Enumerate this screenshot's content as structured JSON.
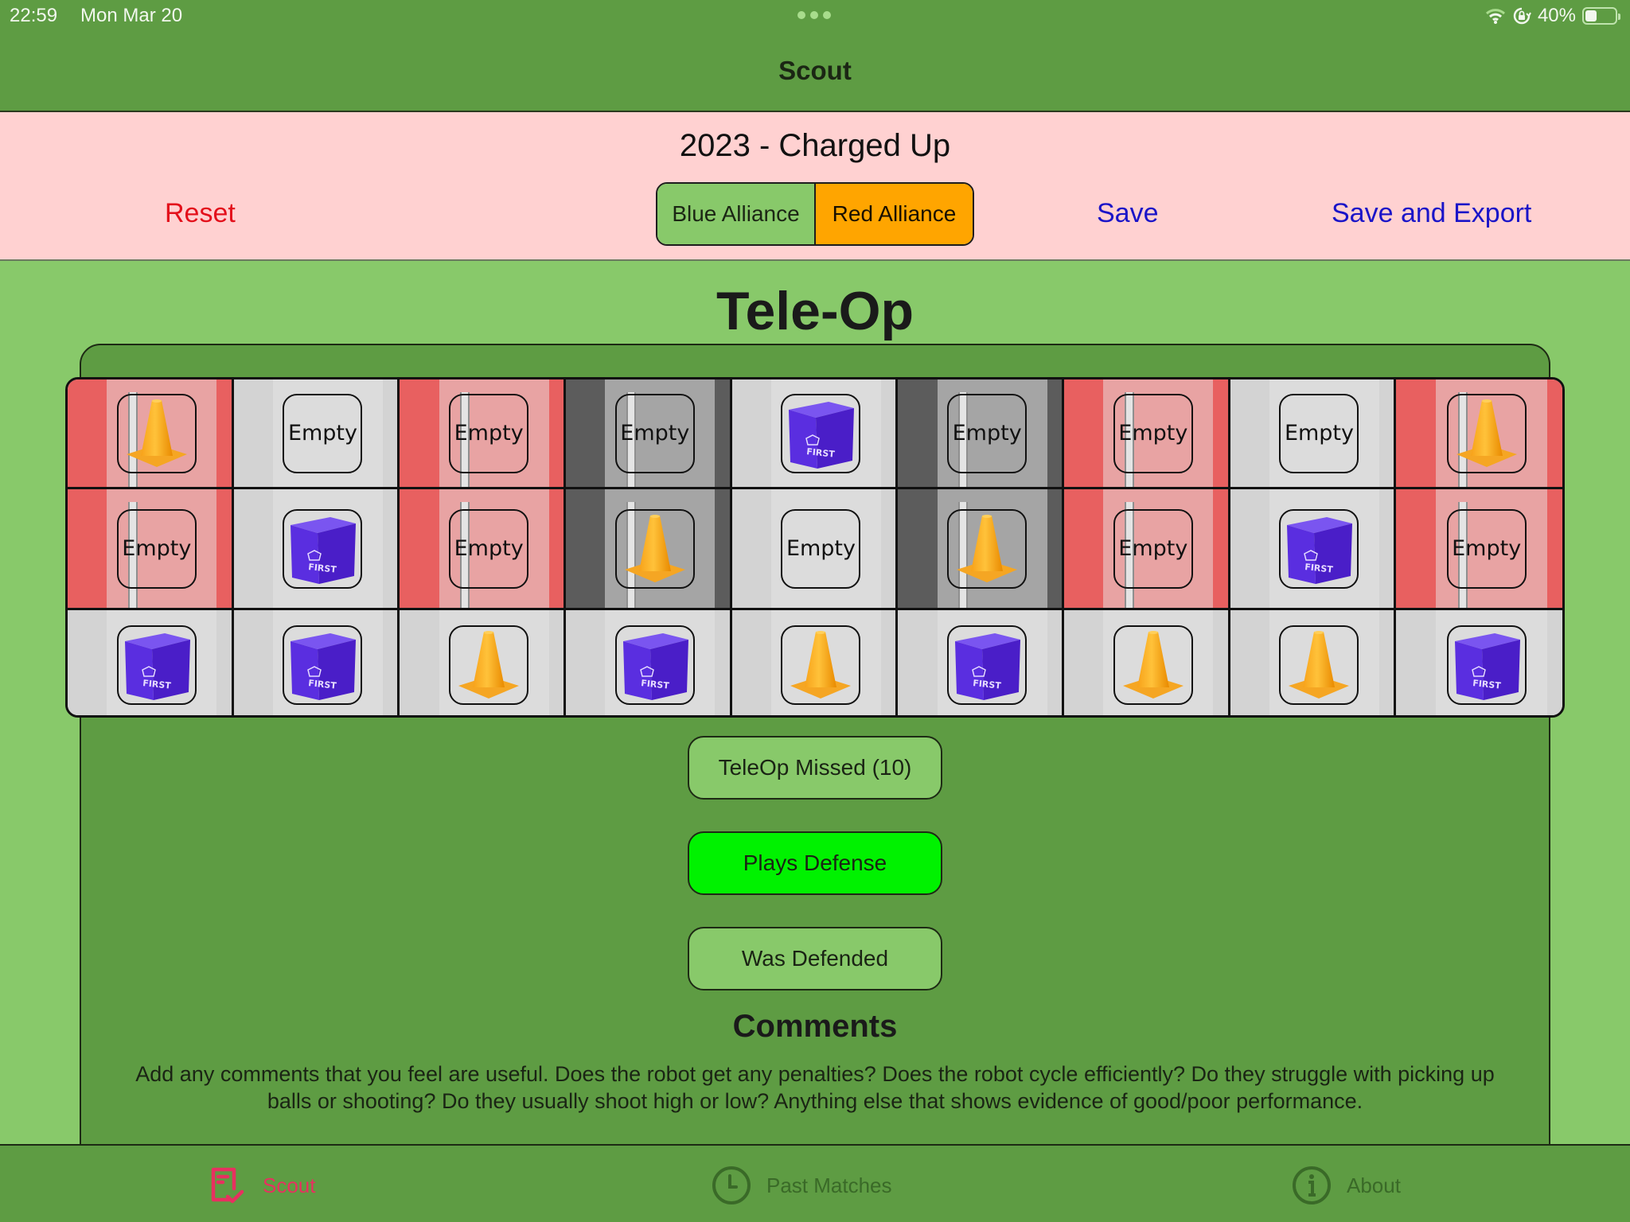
{
  "status_bar": {
    "time": "22:59",
    "date": "Mon Mar 20",
    "battery_percent": "40%",
    "battery_level": 0.4,
    "icons": [
      "wifi-icon",
      "orientation-lock-icon",
      "battery-icon"
    ]
  },
  "nav": {
    "title": "Scout"
  },
  "header": {
    "game_title": "2023 - Charged Up",
    "reset_label": "Reset",
    "save_label": "Save",
    "export_label": "Save and Export",
    "alliance": {
      "options": [
        "Blue Alliance",
        "Red Alliance"
      ],
      "selected": "Red Alliance"
    },
    "colors": {
      "reset": "#e3101b",
      "link": "#1a14c8",
      "selected_alliance": "#ffa500"
    }
  },
  "section_title": "Tele-Op",
  "grid": {
    "empty_label": "Empty",
    "columns": [
      {
        "type": "red",
        "pole": true,
        "rows": [
          "cone",
          "empty",
          "cube"
        ]
      },
      {
        "type": "plain",
        "pole": false,
        "rows": [
          "empty",
          "cube",
          "cube"
        ]
      },
      {
        "type": "red",
        "pole": true,
        "rows": [
          "empty",
          "empty",
          "cone"
        ]
      },
      {
        "type": "gray",
        "pole": true,
        "rows": [
          "empty",
          "cone",
          "cube"
        ]
      },
      {
        "type": "plain",
        "pole": false,
        "rows": [
          "cube",
          "empty",
          "cone"
        ]
      },
      {
        "type": "gray",
        "pole": true,
        "rows": [
          "empty",
          "cone",
          "cube"
        ]
      },
      {
        "type": "red",
        "pole": true,
        "rows": [
          "empty",
          "empty",
          "cone"
        ]
      },
      {
        "type": "plain",
        "pole": false,
        "rows": [
          "empty",
          "cube",
          "cone"
        ]
      },
      {
        "type": "red",
        "pole": true,
        "rows": [
          "cone",
          "empty",
          "cube"
        ]
      }
    ],
    "cube_logo_text": "FIRST"
  },
  "actions": {
    "missed_label": "TeleOp Missed (10)",
    "defense_label": "Plays Defense",
    "defense_active": true,
    "defended_label": "Was Defended",
    "defended_active": false
  },
  "comments": {
    "title": "Comments",
    "help": "Add any comments that you feel are useful. Does the robot get any penalties? Does the robot cycle efficiently? Do they struggle with picking up balls or shooting? Do they usually shoot high or low? Anything else that shows evidence of good/poor performance."
  },
  "tabs": [
    {
      "label": "Scout",
      "icon": "scout-checklist-icon",
      "active": true
    },
    {
      "label": "Past Matches",
      "icon": "clock-icon",
      "active": false
    },
    {
      "label": "About",
      "icon": "info-icon",
      "active": false
    }
  ]
}
